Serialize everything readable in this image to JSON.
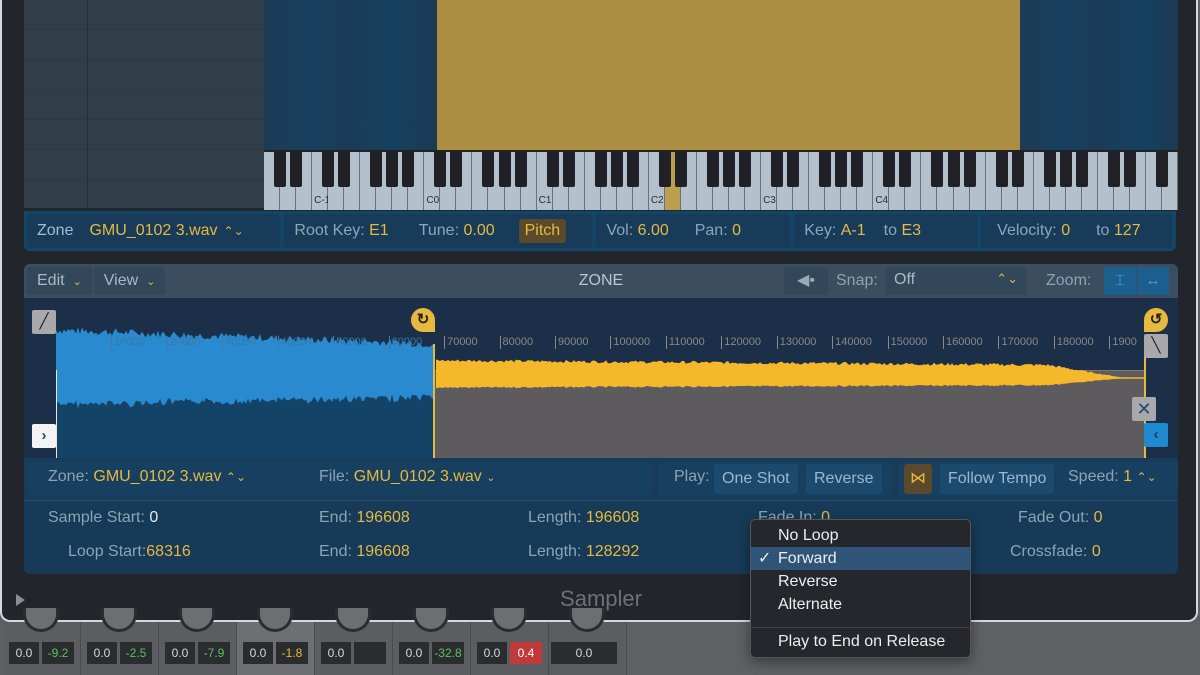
{
  "keyboard": {
    "octave_labels": [
      "C-1",
      "C0",
      "C1",
      "C2",
      "C3",
      "C4"
    ]
  },
  "zone_bar": {
    "zone_label": "Zone",
    "zone_value": "GMU_0102 3.wav",
    "root_key_label": "Root Key:",
    "root_key_value": "E1",
    "tune_label": "Tune:",
    "tune_value": "0.00",
    "pitch_button": "Pitch",
    "vol_label": "Vol:",
    "vol_value": "6.00",
    "pan_label": "Pan:",
    "pan_value": "0",
    "key_label": "Key:",
    "key_from": "A-1",
    "key_to_label": "to",
    "key_to": "E3",
    "velocity_label": "Velocity:",
    "velocity_from": "0",
    "velocity_to_label": "to",
    "velocity_to": "127"
  },
  "toolbar": {
    "edit_label": "Edit",
    "view_label": "View",
    "title": "ZONE",
    "snap_label": "Snap:",
    "snap_value": "Off",
    "zoom_label": "Zoom:"
  },
  "ruler": {
    "ticks": [
      "10000",
      "20000",
      "30000",
      "40000",
      "50000",
      "60000",
      "70000",
      "80000",
      "90000",
      "100000",
      "110000",
      "120000",
      "130000",
      "140000",
      "150000",
      "160000",
      "170000",
      "180000",
      "1900"
    ]
  },
  "waveform": {
    "sample_start": 0,
    "loop_start": 68316,
    "end": 196608
  },
  "zone_row": {
    "zone_label": "Zone:",
    "zone_value": "GMU_0102 3.wav",
    "file_label": "File:",
    "file_value": "GMU_0102 3.wav",
    "play_label": "Play:",
    "one_shot": "One Shot",
    "reverse": "Reverse",
    "follow_tempo": "Follow Tempo",
    "speed_label": "Speed:",
    "speed_value": "1"
  },
  "params": {
    "sample_start_label": "Sample Start:",
    "sample_start_value": "0",
    "end_label": "End:",
    "end_value": "196608",
    "length_label": "Length:",
    "length_value": "196608",
    "fade_in_label": "Fade In:",
    "fade_in_value": "0",
    "fade_out_label": "Fade Out:",
    "fade_out_value": "0",
    "loop_start_label": "Loop Start:",
    "loop_start_value": "68316",
    "loop_end_label": "End:",
    "loop_end_value": "196608",
    "loop_length_label": "Length:",
    "loop_length_value": "128292",
    "crossfade_label": "Crossfade:",
    "crossfade_value": "0"
  },
  "loop_menu": {
    "items": [
      "No Loop",
      "Forward",
      "Reverse",
      "Alternate",
      "Play to End on Release"
    ],
    "selected": "Forward",
    "check": "✓"
  },
  "footer": {
    "title": "Sampler"
  },
  "mixer": {
    "strips": [
      {
        "a": "0.0",
        "b": "-9.2",
        "color": "green"
      },
      {
        "a": "0.0",
        "b": "-2.5",
        "color": "green"
      },
      {
        "a": "0.0",
        "b": "-7.9",
        "color": "green"
      },
      {
        "a": "0.0",
        "b": "-1.8",
        "color": "yellow"
      },
      {
        "a": "0.0",
        "b": "",
        "color": "none"
      },
      {
        "a": "0.0",
        "b": "-32.8",
        "color": "green"
      },
      {
        "a": "0.0",
        "b": "0.4",
        "color": "red"
      },
      {
        "a": "0.0",
        "b": null,
        "color": "none"
      }
    ]
  },
  "colors": {
    "accent_gold": "#e7b93f",
    "accent_blue": "#1c8ed0",
    "panel_blue": "#173b58"
  }
}
